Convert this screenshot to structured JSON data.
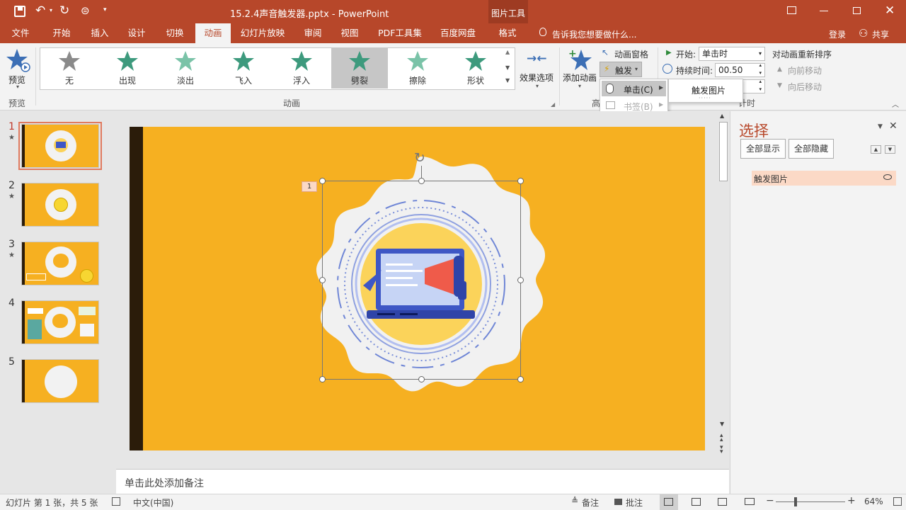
{
  "titlebar": {
    "doc_title": "15.2.4声音触发器.pptx - PowerPoint",
    "context_tool": "图片工具"
  },
  "tabs": [
    "文件",
    "开始",
    "插入",
    "设计",
    "切换",
    "动画",
    "幻灯片放映",
    "审阅",
    "视图",
    "PDF工具集",
    "百度网盘",
    "格式"
  ],
  "tell_me": "告诉我您想要做什么...",
  "login": "登录",
  "share": "共享",
  "ribbon": {
    "preview": "预览",
    "preview_group": "预览",
    "animations_group": "动画",
    "gallery": [
      "无",
      "出现",
      "淡出",
      "飞入",
      "浮入",
      "劈裂",
      "擦除",
      "形状"
    ],
    "effect_options": "效果选项",
    "add_animation": "添加动画",
    "animation_pane": "动画窗格",
    "trigger": "触发",
    "advanced_group_partial": "高",
    "start_label": "开始:",
    "start_value": "单击时",
    "duration_label": "持续时间:",
    "duration_value": "00.50",
    "reorder_title": "对动画重新排序",
    "move_earlier": "向前移动",
    "move_later": "向后移动",
    "timing_group_partial": "计时"
  },
  "trigger_menu": {
    "on_click": "单击(C)",
    "on_bookmark": "书签(B)",
    "submenu_item": "触发图片"
  },
  "slides": [
    {
      "number": "1",
      "has_anim": true
    },
    {
      "number": "2",
      "has_anim": true
    },
    {
      "number": "3",
      "has_anim": true
    },
    {
      "number": "4",
      "has_anim": false
    },
    {
      "number": "5",
      "has_anim": false
    }
  ],
  "slide": {
    "anim_tag": "1"
  },
  "notes_placeholder": "单击此处添加备注",
  "selection_pane": {
    "title": "选择",
    "show_all": "全部显示",
    "hide_all": "全部隐藏",
    "item": "触发图片"
  },
  "status": {
    "slide_info": "幻灯片 第 1 张，共 5 张",
    "language": "中文(中国)",
    "notes": "备注",
    "comments": "批注",
    "zoom": "64%"
  },
  "colors": {
    "accent": "#b7472a",
    "slide_bg": "#f6b021",
    "dark_bar": "#2b1c0a"
  }
}
